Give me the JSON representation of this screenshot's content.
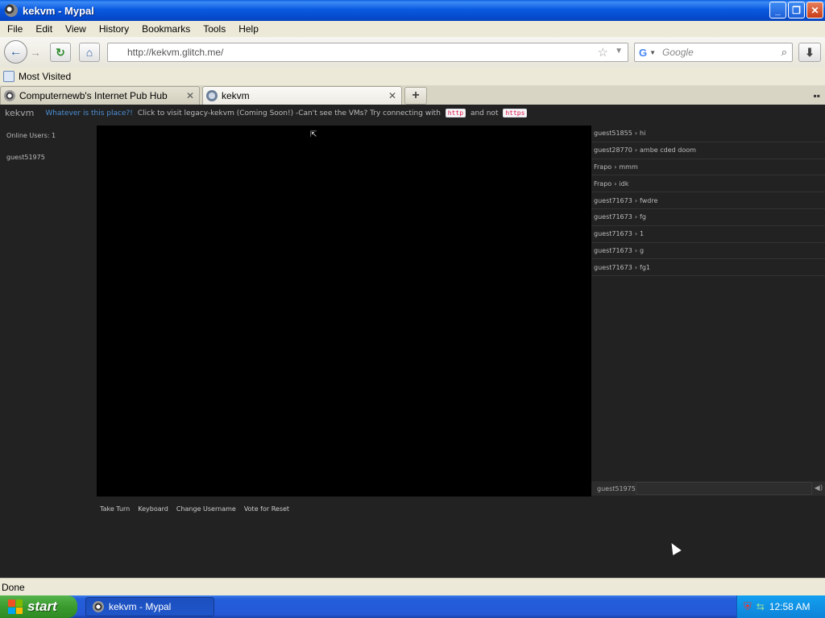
{
  "window": {
    "title": "kekvm - Mypal",
    "minimize": "_",
    "maximize": "❐",
    "close": "✕"
  },
  "menu": [
    "File",
    "Edit",
    "View",
    "History",
    "Bookmarks",
    "Tools",
    "Help"
  ],
  "nav": {
    "back": "←",
    "forward": "→",
    "reload": "↻",
    "home": "⌂",
    "url": "http://kekvm.glitch.me/",
    "bookmark_star": "☆",
    "search_engine": "G",
    "search_placeholder": "Google",
    "download": "⬇"
  },
  "bookmarks": {
    "items": [
      "Most Visited"
    ]
  },
  "tabs": [
    {
      "label": "Computernewb's Internet Pub Hub"
    },
    {
      "label": "kekvm"
    }
  ],
  "page": {
    "brand": "kekvm",
    "info_link": "Whatever is this place?!",
    "notice_prefix": "Click to visit legacy-kekvm (Coming Soon!) -Can't see the VMs? Try connecting with",
    "notice_code1": "http",
    "notice_mid": "and not",
    "notice_code2": "https",
    "online_users_label": "Online Users: 1",
    "users": [
      "guest51975"
    ],
    "chat": [
      {
        "user": "guest51855",
        "msg": "hi"
      },
      {
        "user": "guest28770",
        "msg": "ambe cded doom"
      },
      {
        "user": "Frapo",
        "msg": "mmm"
      },
      {
        "user": "Frapo",
        "msg": "idk"
      },
      {
        "user": "guest71673",
        "msg": "fwdre"
      },
      {
        "user": "guest71673",
        "msg": "fg"
      },
      {
        "user": "guest71673",
        "msg": "1"
      },
      {
        "user": "guest71673",
        "msg": "g"
      },
      {
        "user": "guest71673",
        "msg": "fg1"
      }
    ],
    "chat_username": "guest51975",
    "actions": [
      "Take Turn",
      "Keyboard",
      "Change Username",
      "Vote for Reset"
    ]
  },
  "status": "Done",
  "taskbar": {
    "start": "start",
    "task": "kekvm - Mypal",
    "clock": "12:58 AM"
  }
}
